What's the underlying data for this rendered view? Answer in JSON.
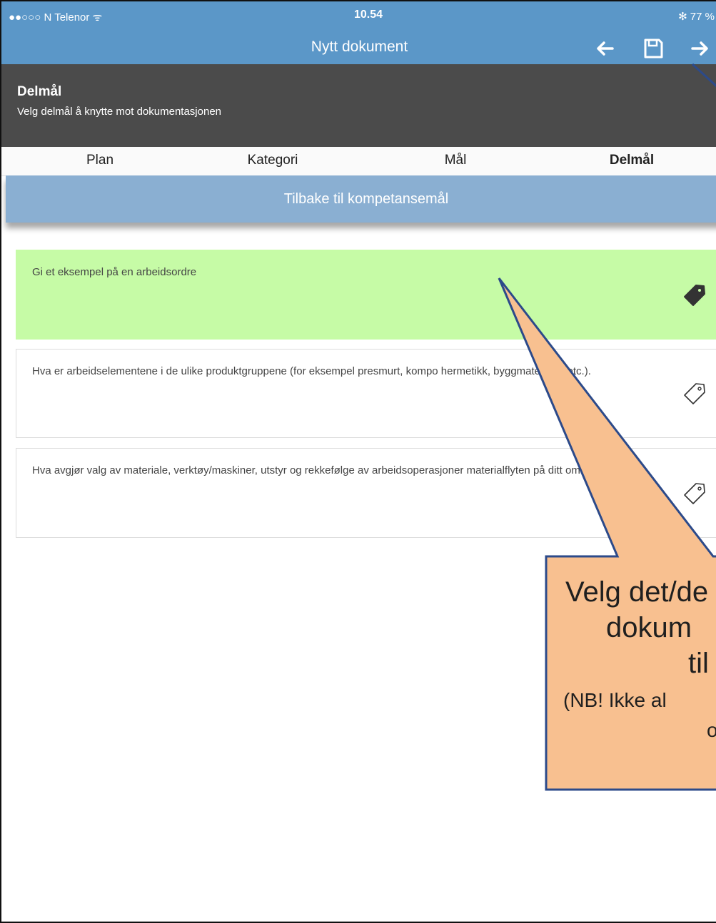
{
  "status_bar": {
    "carrier": "●●○○○ N Telenor ᯤ",
    "time": "10.54",
    "battery": "✻ 77 %"
  },
  "nav": {
    "title": "Nytt dokument",
    "back_icon": "arrow-left-icon",
    "save_icon": "save-icon",
    "forward_icon": "arrow-right-icon"
  },
  "header": {
    "title": "Delmål",
    "subtitle": "Velg delmål å knytte mot dokumentasjonen"
  },
  "tabs": [
    {
      "label": "Plan",
      "active": false
    },
    {
      "label": "Kategori",
      "active": false
    },
    {
      "label": "Mål",
      "active": false
    },
    {
      "label": "Delmål",
      "active": true
    }
  ],
  "back_button": {
    "label": "Tilbake til kompetansemål"
  },
  "items": [
    {
      "text": "Gi et eksempel på en arbeidsordre",
      "selected": true,
      "icon": "tag-filled-icon"
    },
    {
      "text": "Hva er arbeidselementene i de ulike produktgruppene (for eksempel presmurt, kompo     hermetikk, byggmaterialer etc.).",
      "selected": false,
      "icon": "tag-outline-icon"
    },
    {
      "text": "Hva avgjør valg av materiale, verktøy/maskiner, utstyr og rekkefølge av arbeidsoperasjoner materialflyten på ditt område.",
      "selected": false,
      "icon": "tag-outline-icon"
    }
  ],
  "callout": {
    "line1": "Velg det/de",
    "line2": "dokum",
    "line3": "til",
    "line4": "(NB! Ikke al",
    "line5": "o",
    "fill": "#f8c090",
    "stroke": "#2c4a8a"
  },
  "colors": {
    "bar": "#5b97c8",
    "header": "#4b4b4b",
    "back_bar": "#8aafd2",
    "selected": "#c6fba6"
  }
}
